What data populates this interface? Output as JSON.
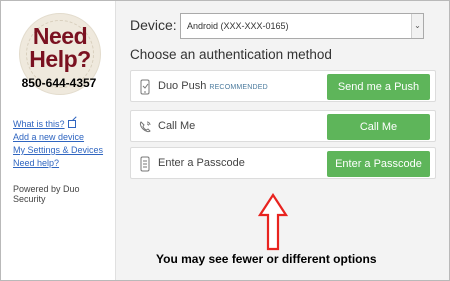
{
  "branding": {
    "headline": "Need Help?",
    "phone": "850-644-4357",
    "accent": "#7a1120"
  },
  "sidebar": {
    "links": [
      "What is this?",
      "Add a new device",
      "My Settings & Devices",
      "Need help?"
    ],
    "powered_by": "Powered by Duo Security"
  },
  "device": {
    "label": "Device:",
    "selected": "Android (XXX-XXX-0165)"
  },
  "auth": {
    "heading": "Choose an authentication method",
    "methods": [
      {
        "label": "Duo Push",
        "tag": "RECOMMENDED",
        "button": "Send me a Push",
        "icon": "phone-icon"
      },
      {
        "label": "Call Me",
        "tag": "",
        "button": "Call Me",
        "icon": "call-icon"
      },
      {
        "label": "Enter a Passcode",
        "tag": "",
        "button": "Enter a Passcode",
        "icon": "passcode-icon"
      }
    ],
    "button_color": "#5eb55a"
  },
  "annotation": {
    "text": "You may see fewer or different options",
    "arrow_color": "#e8231f"
  }
}
